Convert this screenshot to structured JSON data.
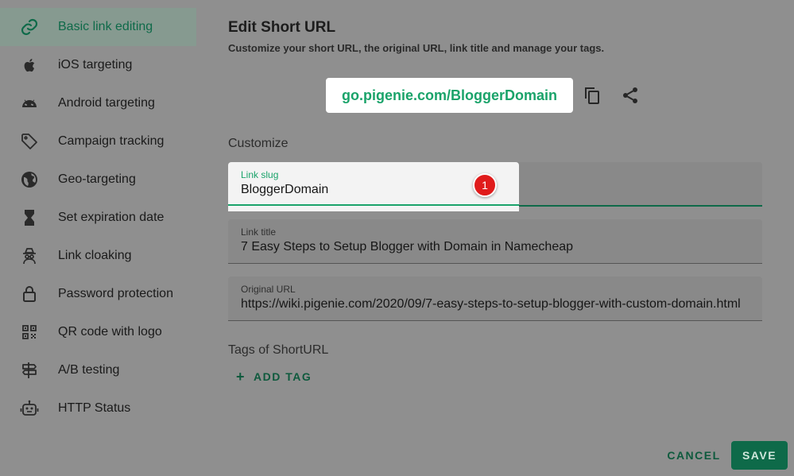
{
  "sidebar": {
    "items": [
      {
        "label": "Basic link editing",
        "icon": "link-icon"
      },
      {
        "label": "iOS targeting",
        "icon": "apple-icon"
      },
      {
        "label": "Android targeting",
        "icon": "android-icon"
      },
      {
        "label": "Campaign tracking",
        "icon": "tag-icon"
      },
      {
        "label": "Geo-targeting",
        "icon": "globe-icon"
      },
      {
        "label": "Set expiration date",
        "icon": "hourglass-icon"
      },
      {
        "label": "Link cloaking",
        "icon": "spy-icon"
      },
      {
        "label": "Password protection",
        "icon": "lock-icon"
      },
      {
        "label": "QR code with logo",
        "icon": "qr-code-icon"
      },
      {
        "label": "A/B testing",
        "icon": "signpost-icon"
      },
      {
        "label": "HTTP Status",
        "icon": "robot-icon"
      }
    ]
  },
  "header": {
    "title": "Edit Short URL",
    "subtitle": "Customize your short URL, the original URL, link title and manage your tags."
  },
  "short_url": "go.pigenie.com/BloggerDomain",
  "customize": {
    "section_label": "Customize",
    "slug": {
      "label": "Link slug",
      "value": "BloggerDomain",
      "badge": "1"
    },
    "title": {
      "label": "Link title",
      "value": "7 Easy Steps to Setup Blogger with Domain in Namecheap"
    },
    "original_url": {
      "label": "Original URL",
      "value": "https://wiki.pigenie.com/2020/09/7-easy-steps-to-setup-blogger-with-custom-domain.html"
    }
  },
  "tags": {
    "section_label": "Tags of ShortURL",
    "add_label": "ADD TAG"
  },
  "actions": {
    "cancel_label": "CANCEL",
    "save_label": "SAVE"
  },
  "colors": {
    "accent": "#1aa36a",
    "primary_dark": "#0e6a49",
    "overlay_gray": "#8f8f8f",
    "badge_red": "#e01b1b"
  }
}
